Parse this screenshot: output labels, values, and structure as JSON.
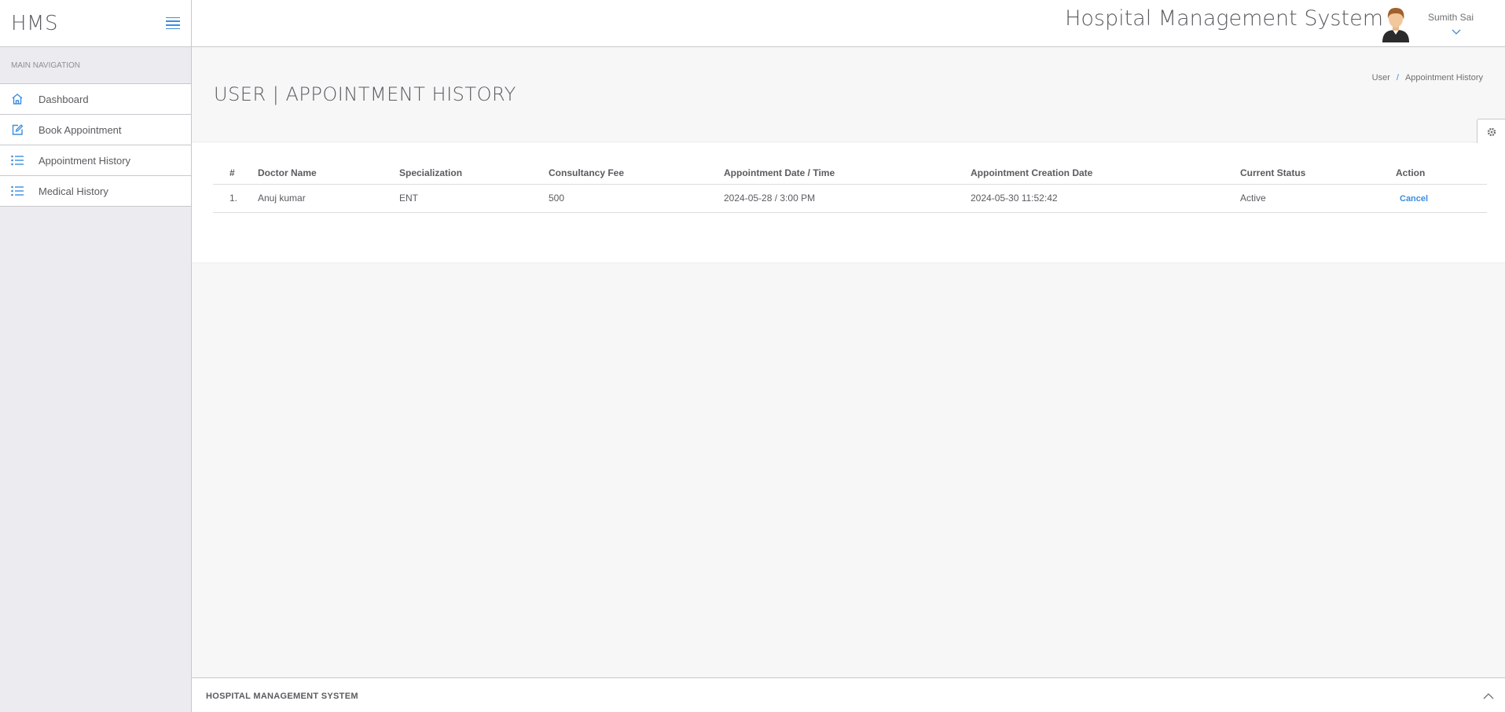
{
  "brand": {
    "name": "HMS"
  },
  "sidebar": {
    "nav_title": "Main Navigation",
    "items": [
      {
        "label": "Dashboard",
        "icon": "home-icon"
      },
      {
        "label": "Book Appointment",
        "icon": "edit-icon"
      },
      {
        "label": "Appointment History",
        "icon": "list-icon"
      },
      {
        "label": "Medical History",
        "icon": "list-icon"
      }
    ]
  },
  "header": {
    "title": "Hospital Management System",
    "user_name": "Sumith Sai"
  },
  "page": {
    "title": "USER | APPOINTMENT HISTORY",
    "breadcrumb": [
      "User",
      "Appointment History"
    ],
    "breadcrumb_sep": "/"
  },
  "table": {
    "headers": [
      "#",
      "Doctor Name",
      "Specialization",
      "Consultancy Fee",
      "Appointment Date / Time",
      "Appointment Creation Date",
      "Current Status",
      "Action"
    ],
    "rows": [
      {
        "num": "1.",
        "doctor": "Anuj kumar",
        "specialization": "ENT",
        "fee": "500",
        "appointment_datetime": "2024-05-28 / 3:00 PM",
        "created": "2024-05-30 11:52:42",
        "status": "Active",
        "action": "Cancel"
      }
    ]
  },
  "footer": {
    "text": "Hospital Management System"
  },
  "colors": {
    "accent": "#3c8dde",
    "text": "#5b5b60",
    "sidebar_bg": "#ececf0"
  }
}
